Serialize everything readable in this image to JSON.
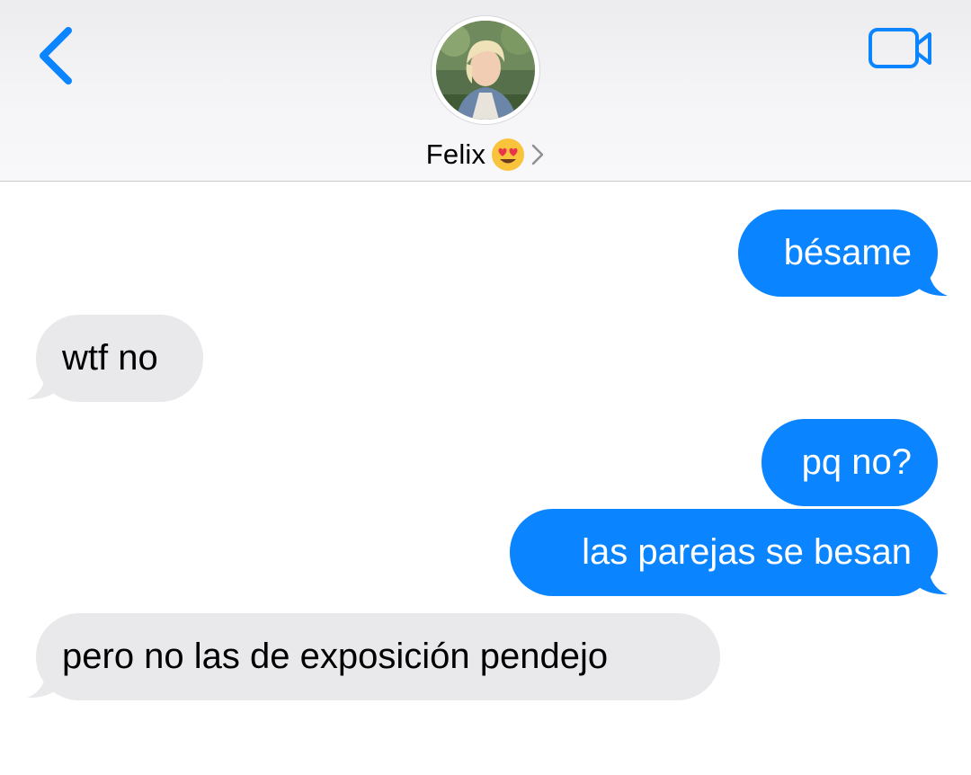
{
  "header": {
    "contact_name": "Felix",
    "contact_emoji": "smiling-face-with-heart-eyes",
    "icons": {
      "back": "chevron-left-icon",
      "video": "video-camera-icon",
      "disclosure": "chevron-right-icon"
    }
  },
  "messages": [
    {
      "direction": "sent",
      "text": "bésame"
    },
    {
      "direction": "received",
      "text": "wtf no"
    },
    {
      "direction": "sent",
      "text": "pq no?"
    },
    {
      "direction": "sent",
      "text": "las parejas se besan"
    },
    {
      "direction": "received",
      "text": "pero no las de exposición pendejo"
    }
  ],
  "colors": {
    "accent": "#0a84ff",
    "sent_bubble": "#0a84ff",
    "received_bubble": "#e9e9eb",
    "header_bg": "#f4f4f6"
  }
}
